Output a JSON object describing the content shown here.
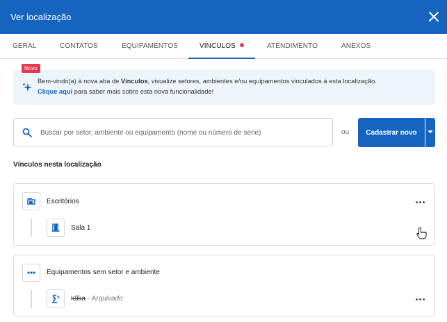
{
  "window": {
    "title": "Ver localização"
  },
  "tabs": [
    {
      "label": "GERAL"
    },
    {
      "label": "CONTATOS"
    },
    {
      "label": "EQUIPAMENTOS"
    },
    {
      "label": "VÍNCULOS",
      "active": true
    },
    {
      "label": "ATENDIMENTO"
    },
    {
      "label": "ANEXOS"
    }
  ],
  "info": {
    "badge": "Novo",
    "text_before": "Bem-vindo(a) à nova aba de ",
    "text_bold": "Vínculos",
    "text_after": ", visualize setores, ambientes e/ou equipamentos vinculados à esta localização.",
    "link": "Clique aqui",
    "link_after": " para saber mais sobre esta nova funcionalidade!"
  },
  "search": {
    "placeholder": "Buscar por setor, ambiente ou equipamento (nome ou número de série)",
    "value": ""
  },
  "or_label": "ou",
  "new_button": "Cadastrar novo",
  "section_title": "Vínculos nesta localização",
  "groups": [
    {
      "name": "Escritórios",
      "icon": "sector-icon",
      "children": [
        {
          "name": "Sala 1",
          "icon": "door-icon"
        }
      ]
    },
    {
      "name": "Equipamentos sem setor e ambiente",
      "icon": "more-horizontal-icon",
      "children": [
        {
          "name": "Idika",
          "status": " - Arquivado",
          "icon": "robot-arm-icon"
        }
      ]
    }
  ],
  "colors": {
    "primary": "#1565c0",
    "badge": "#e53950",
    "info_bg": "#eef4fb"
  }
}
